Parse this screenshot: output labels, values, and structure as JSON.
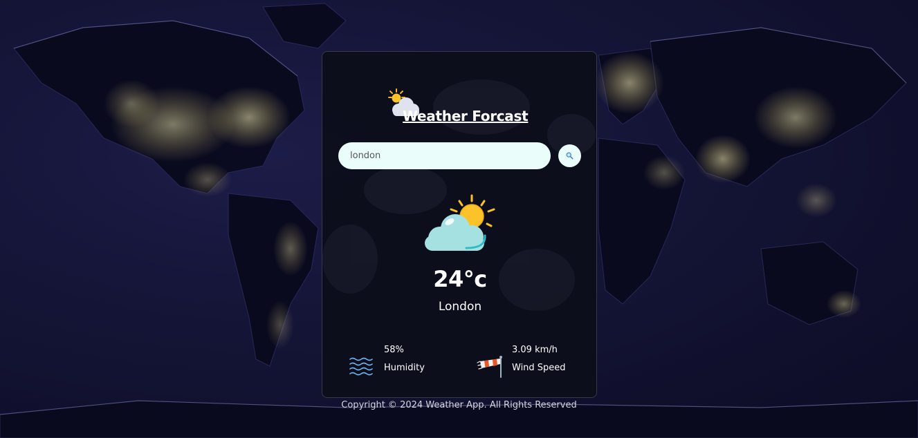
{
  "app": {
    "title": "Weather Forcast",
    "title_icon": "sun-cloud-icon"
  },
  "search": {
    "value": "london",
    "placeholder": "",
    "button_icon": "search-icon"
  },
  "current": {
    "icon": "partly-cloudy-icon",
    "temperature": "24°c",
    "city": "London"
  },
  "stats": {
    "humidity": {
      "icon": "waves-icon",
      "value": "58%",
      "label": "Humidity"
    },
    "wind": {
      "icon": "windsock-icon",
      "value": "3.09 km/h",
      "label": "Wind Speed"
    }
  },
  "footer": {
    "text": "Copyright © 2024 Weather App. All Rights Reserved"
  },
  "colors": {
    "background": "#141436",
    "card": "#0c0e1a",
    "input": "#ebfdfb",
    "city_lights": "#f3ecb0",
    "sun": "#fcc22a",
    "cloud": "#a6e1e1"
  }
}
